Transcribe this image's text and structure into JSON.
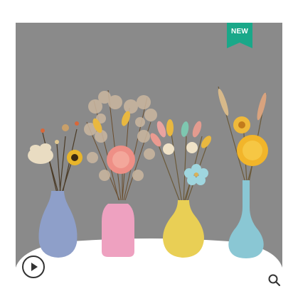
{
  "product_image": {
    "badge": {
      "label": "NEW",
      "color": "#1aa889"
    },
    "vases": [
      {
        "name": "blue-vase",
        "color": "#8e9fc9"
      },
      {
        "name": "pink-vase",
        "color": "#eea1c0"
      },
      {
        "name": "yellow-vase",
        "color": "#e9cf55"
      },
      {
        "name": "teal-vase",
        "color": "#8ac7d4"
      }
    ],
    "controls": {
      "play_icon": "play-icon",
      "zoom_icon": "magnifier-icon"
    }
  }
}
